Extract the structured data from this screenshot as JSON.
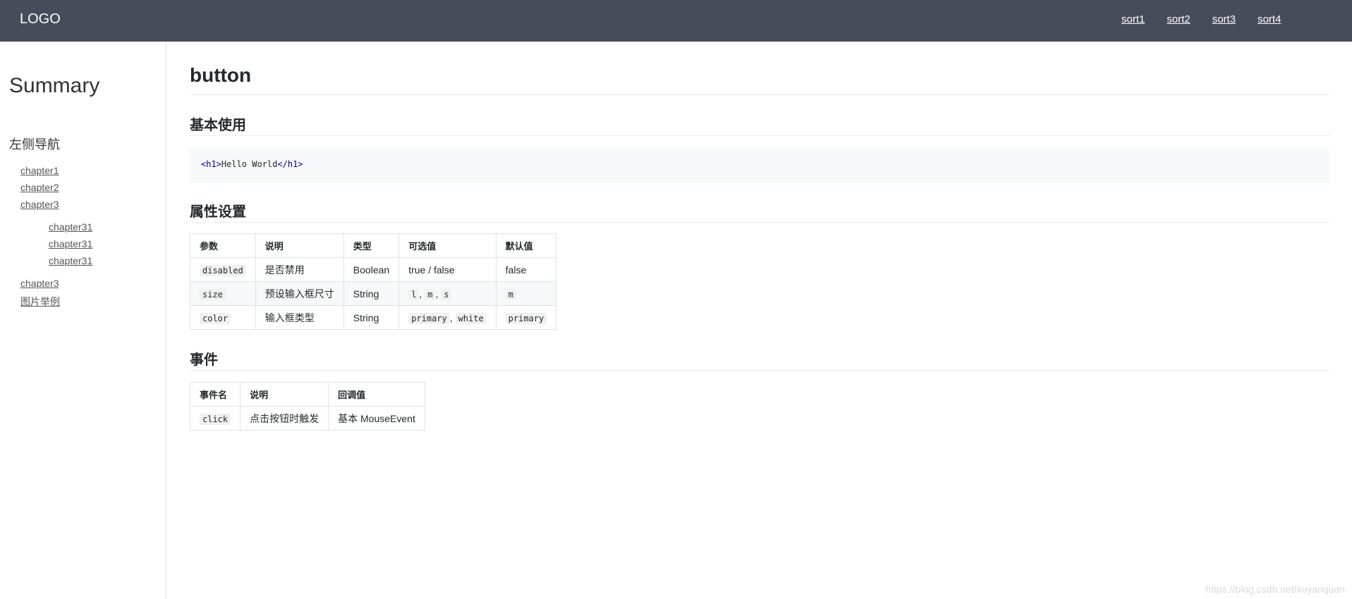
{
  "header": {
    "logo": "LOGO",
    "nav": [
      "sort1",
      "sort2",
      "sort3",
      "sort4"
    ]
  },
  "sidebar": {
    "title": "Summary",
    "section": "左侧导航",
    "items": [
      {
        "label": "chapter1",
        "level": 1
      },
      {
        "label": "chapter2",
        "level": 1
      },
      {
        "label": "chapter3",
        "level": 1
      },
      {
        "label": "chapter31",
        "level": 2
      },
      {
        "label": "chapter31",
        "level": 2
      },
      {
        "label": "chapter31",
        "level": 2
      },
      {
        "label": "chapter3",
        "level": 1
      },
      {
        "label": "图片举例",
        "level": 1
      }
    ]
  },
  "main": {
    "title": "button",
    "basic": {
      "heading": "基本使用",
      "code": {
        "open_tag": "<h1>",
        "text": "Hello World",
        "close_tag": "</h1>"
      }
    },
    "props": {
      "heading": "属性设置",
      "columns": [
        "参数",
        "说明",
        "类型",
        "可选值",
        "默认值"
      ],
      "rows": [
        {
          "param": "disabled",
          "desc": "是否禁用",
          "type": "Boolean",
          "options": "true / false",
          "default": "false"
        },
        {
          "param": "size",
          "desc": "预设输入框尺寸",
          "type": "String",
          "options": [
            "l",
            "m",
            "s"
          ],
          "default": "m"
        },
        {
          "param": "color",
          "desc": "输入框类型",
          "type": "String",
          "options": [
            "primary",
            "white"
          ],
          "default": "primary"
        }
      ]
    },
    "events": {
      "heading": "事件",
      "columns": [
        "事件名",
        "说明",
        "回调值"
      ],
      "rows": [
        {
          "name": "click",
          "desc": "点击按钮时触发",
          "callback": "基本 MouseEvent"
        }
      ]
    }
  },
  "watermark": "https://blog.csdn.net/xuyanquan"
}
